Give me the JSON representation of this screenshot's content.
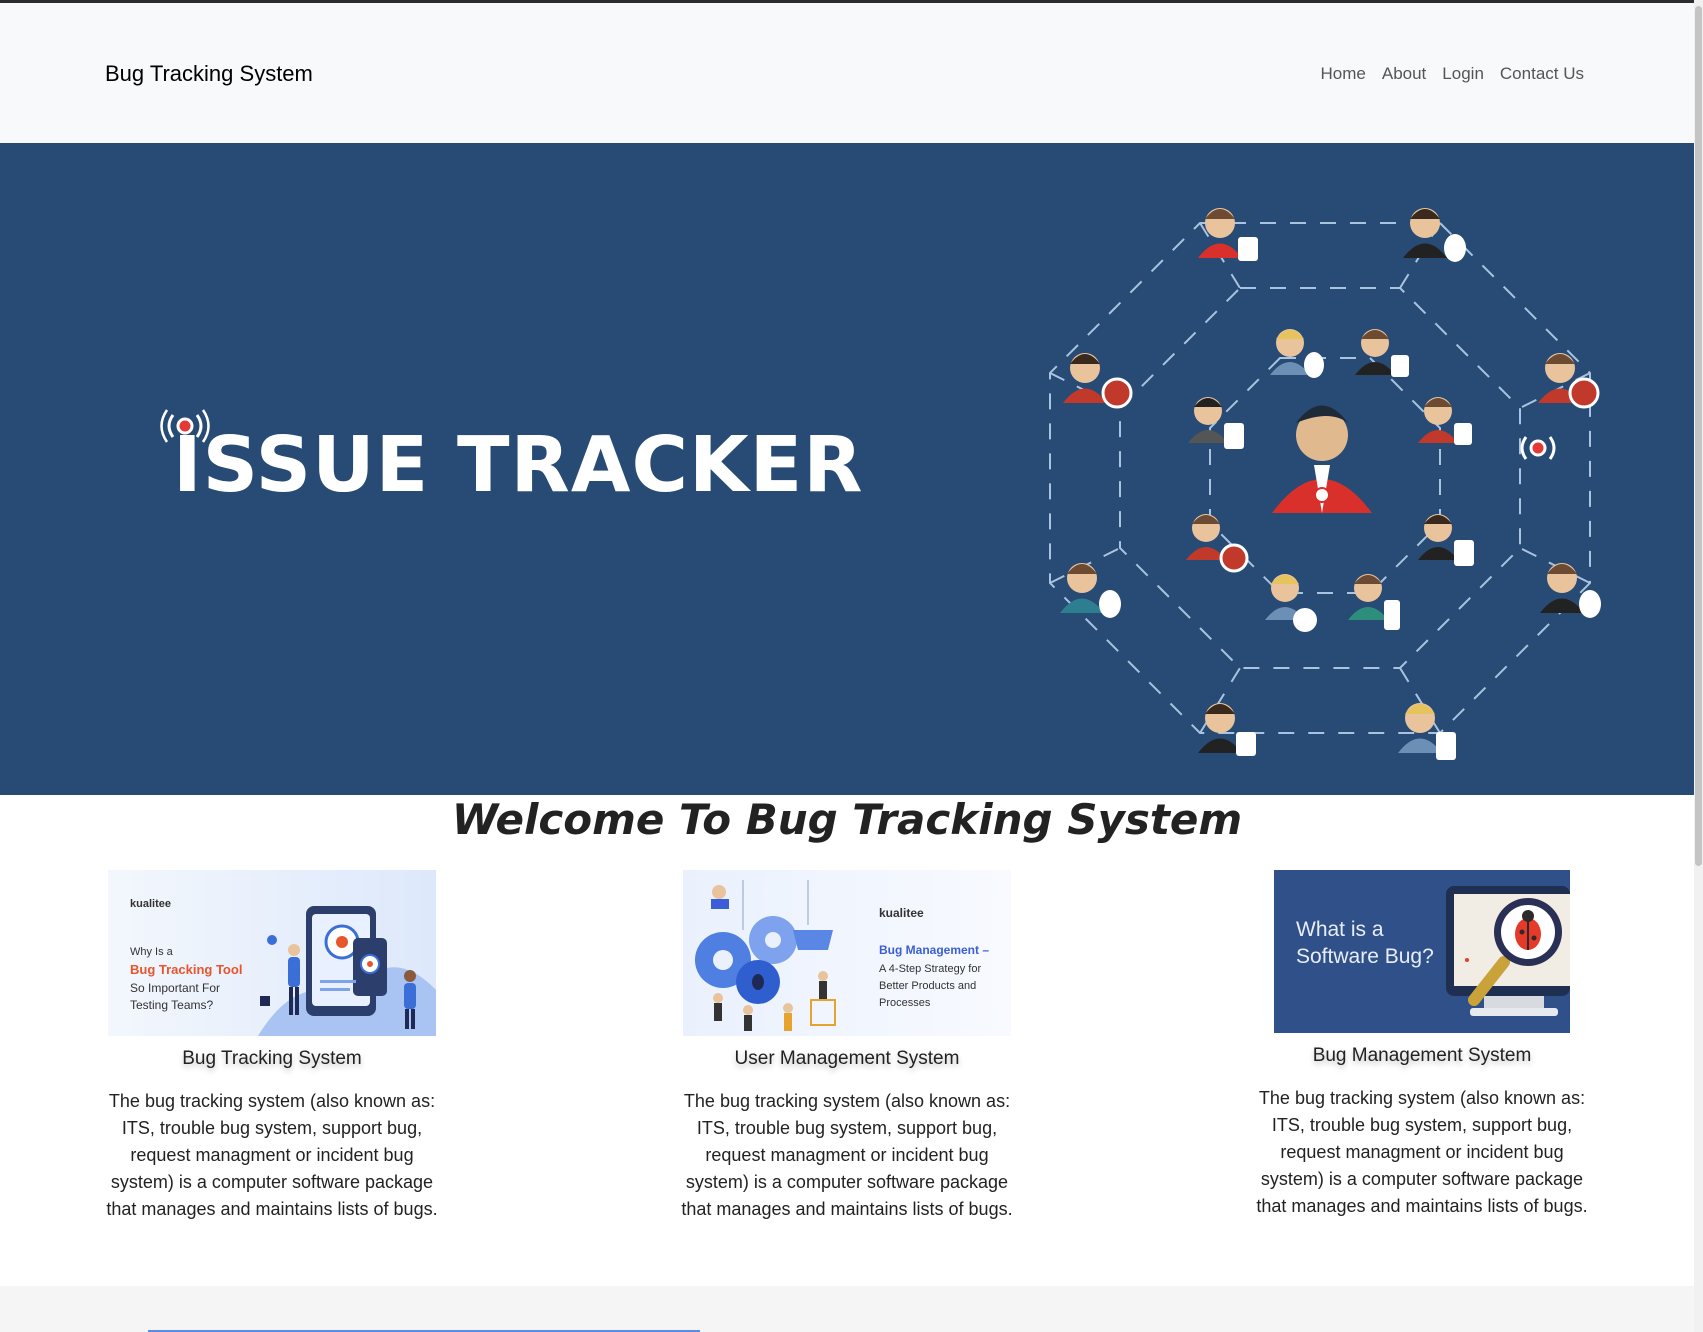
{
  "navbar": {
    "brand": "Bug Tracking System",
    "links": [
      "Home",
      "About",
      "Login",
      "Contact Us"
    ]
  },
  "hero": {
    "title": "ISSUE TRACKER",
    "background": "#274b74"
  },
  "welcome": "Welcome To Bug Tracking System",
  "cards": [
    {
      "thumb": {
        "logo": "kualitee",
        "line1": "Why Is a",
        "line2": "Bug Tracking Tool",
        "line3": "So Important For",
        "line4": "Testing Teams?"
      },
      "title": "Bug Tracking System",
      "text": "The bug tracking system (also known as: ITS, trouble bug system, support bug, request managment or incident bug system) is a computer software package that manages and maintains lists of bugs."
    },
    {
      "thumb": {
        "logo": "kualitee",
        "line1": "Bug Management –",
        "line2": "A 4-Step Strategy for",
        "line3": "Better Products and",
        "line4": "Processes"
      },
      "title": "User Management System",
      "text": "The bug tracking system (also known as: ITS, trouble bug system, support bug, request managment or incident bug system) is a computer software package that manages and maintains lists of bugs."
    },
    {
      "thumb": {
        "line1": "What is a",
        "line2": "Software Bug?"
      },
      "title": "Bug Management System",
      "text": "The bug tracking system (also known as: ITS, trouble bug system, support bug, request managment or incident bug system) is a computer software package that manages and maintains lists of bugs."
    }
  ]
}
